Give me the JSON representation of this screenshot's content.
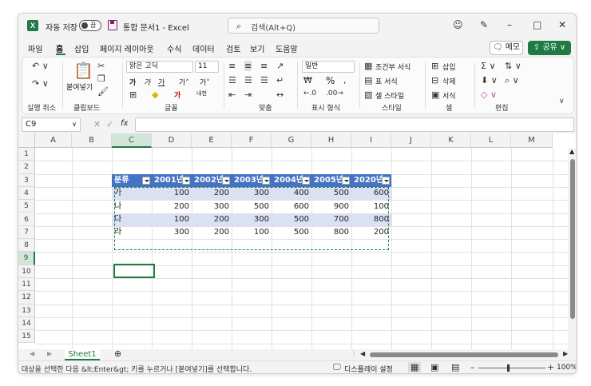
{
  "titlebar": {
    "app_logo": "X",
    "autosave_label": "자동 저장",
    "autosave_state": "끔",
    "doc_title": "통합 문서1  -  Excel",
    "search_placeholder": "검색(Alt+Q)",
    "icons": [
      "search-icon",
      "person-icon",
      "pen-icon",
      "minimize-icon",
      "maximize-icon",
      "close-icon"
    ]
  },
  "tabs": [
    "파일",
    "홈",
    "삽입",
    "페이지 레이아웃",
    "수식",
    "데이터",
    "검토",
    "보기",
    "도움말"
  ],
  "active_tab": "홈",
  "memo_label": "메모",
  "share_label": "공유",
  "ribbon": {
    "groups": [
      "실행 취소",
      "클립보드",
      "글꼴",
      "맞춤",
      "표시 형식",
      "스타일",
      "셀",
      "편집"
    ],
    "paste_label": "붙여넣기",
    "font_name": "맑은 고딕",
    "font_size": "11",
    "number_format": "일반",
    "cond_format": "조건부 서식",
    "table_format": "표 서식",
    "cell_style": "셀 스타일",
    "insert": "삽입",
    "delete": "삭제",
    "format": "서식",
    "percent": "%"
  },
  "formula_bar": {
    "name_box": "C9",
    "fx": "fx",
    "value": ""
  },
  "columns": [
    "A",
    "B",
    "C",
    "D",
    "E",
    "F",
    "G",
    "H",
    "I",
    "J",
    "K",
    "L",
    "M"
  ],
  "selected_column": "C",
  "rows": [
    "1",
    "2",
    "3",
    "4",
    "5",
    "6",
    "7",
    "8",
    "9",
    "10",
    "11",
    "12",
    "13",
    "14",
    "15"
  ],
  "selected_row": "9",
  "table": {
    "headers": [
      "분류",
      "2001년",
      "2002년",
      "2003년",
      "2004년",
      "2005년",
      "2020년"
    ],
    "rows": [
      [
        "가",
        "100",
        "200",
        "300",
        "400",
        "500",
        "600"
      ],
      [
        "나",
        "200",
        "300",
        "500",
        "600",
        "900",
        "100"
      ],
      [
        "다",
        "100",
        "200",
        "300",
        "500",
        "700",
        "800"
      ],
      [
        "라",
        "300",
        "200",
        "100",
        "500",
        "800",
        "200"
      ]
    ],
    "header_color": "#4472c4",
    "band_color": "#d9e1f2"
  },
  "sheet_tab": "Sheet1",
  "status": {
    "message": "대상을 선택한 다음 &lt;Enter&gt; 키를 누르거나 [붙여넣기]를 선택합니다.",
    "display_settings": "디스플레이 설정",
    "zoom": "100%"
  },
  "accent_color": "#1f7a43"
}
